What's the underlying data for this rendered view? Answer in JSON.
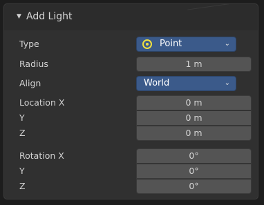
{
  "panel": {
    "title": "Add Light",
    "collapse_icon": "triangle-down-icon"
  },
  "rows": {
    "type": {
      "label": "Type",
      "value": "Point",
      "icon": "point-light-icon"
    },
    "radius": {
      "label": "Radius",
      "value": "1 m"
    },
    "align": {
      "label": "Align",
      "value": "World"
    },
    "location": {
      "label": "Location X",
      "x": "0 m",
      "y_label": "Y",
      "y": "0 m",
      "z_label": "Z",
      "z": "0 m"
    },
    "rotation": {
      "label": "Rotation X",
      "x": "0°",
      "y_label": "Y",
      "y": "0°",
      "z_label": "Z",
      "z": "0°"
    }
  },
  "colors": {
    "panel_bg": "#303030",
    "field_bg": "#545454",
    "select_bg": "#3b5a8a",
    "point_icon": "#f0e040"
  }
}
